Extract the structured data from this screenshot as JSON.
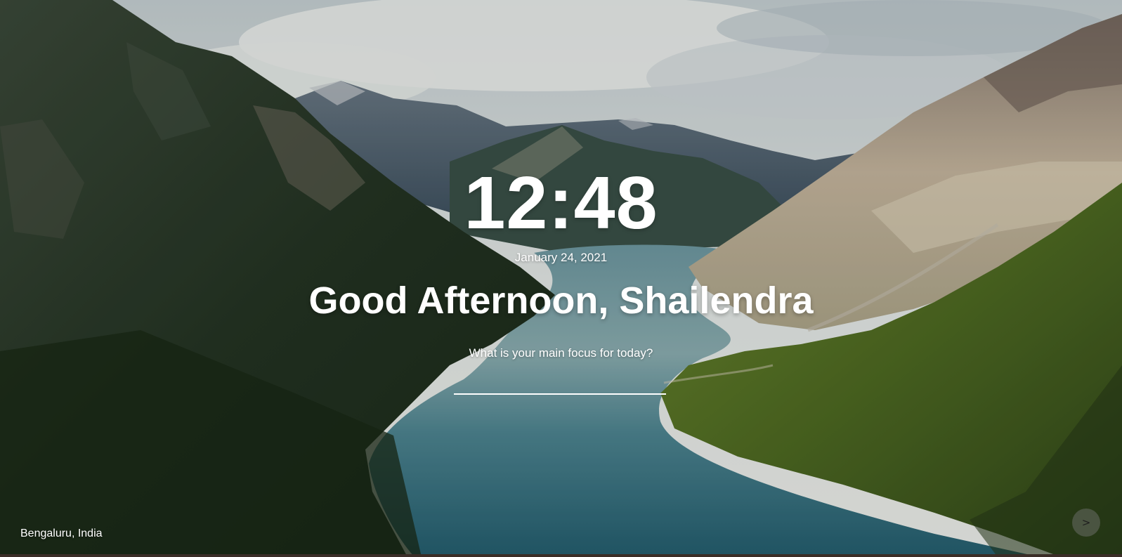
{
  "clock": {
    "time": "12:48"
  },
  "date": {
    "text": "January 24, 2021"
  },
  "greeting": {
    "text": "Good Afternoon, Shailendra"
  },
  "focus": {
    "question": "What is your main focus for today?",
    "value": "",
    "placeholder": ""
  },
  "location": {
    "text": "Bengaluru, India"
  },
  "navigation": {
    "next_label": ">"
  },
  "background": {
    "scene": "mountain-lake-landscape",
    "colors": {
      "sky": "#dfe6e6",
      "forest_dark": "#1f2e1d",
      "forest_light": "#5d7a2a",
      "water": "#3f7f8c",
      "rock": "#a99b8c"
    }
  }
}
